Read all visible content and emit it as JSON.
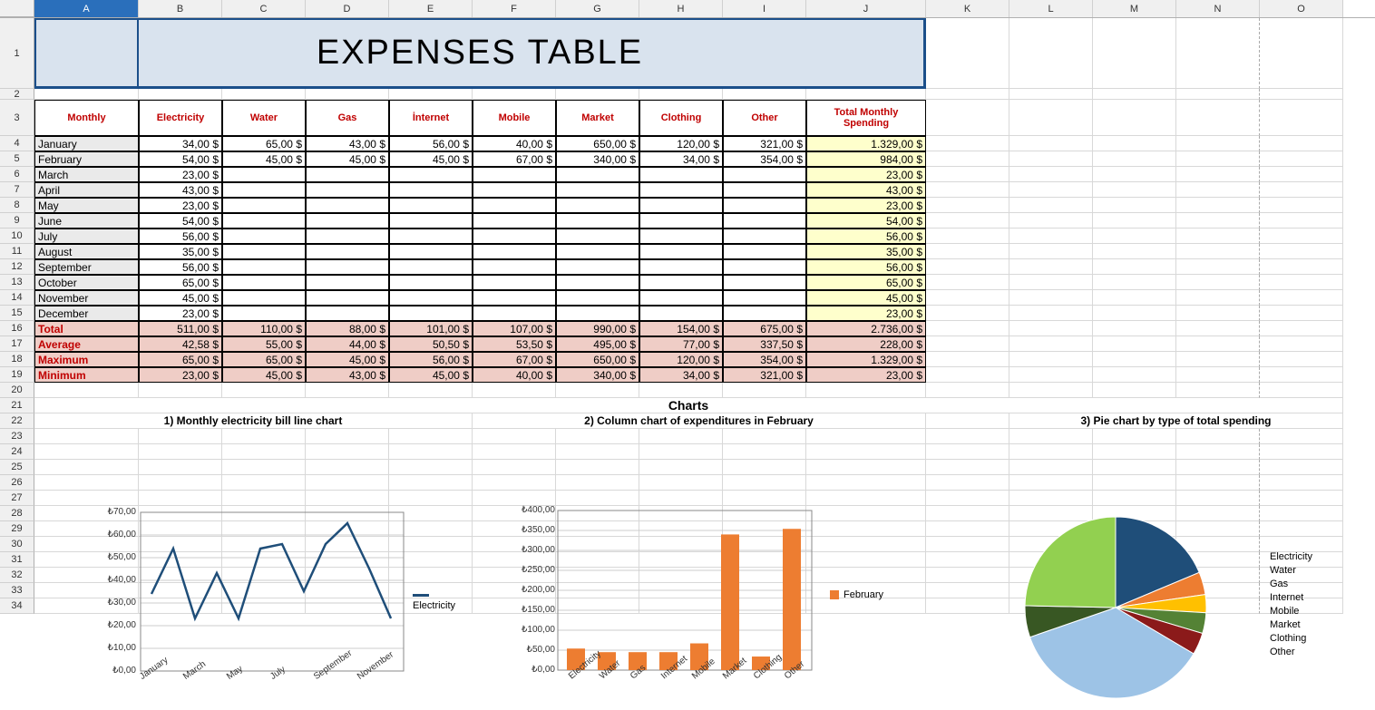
{
  "columns": [
    "A",
    "B",
    "C",
    "D",
    "E",
    "F",
    "G",
    "H",
    "I",
    "J",
    "K",
    "L",
    "M",
    "N",
    "O"
  ],
  "row_numbers": [
    1,
    2,
    3,
    4,
    5,
    6,
    7,
    8,
    9,
    10,
    11,
    12,
    13,
    14,
    15,
    16,
    17,
    18,
    19,
    20,
    21,
    22,
    23,
    24,
    25,
    26,
    27,
    28,
    29,
    30,
    31,
    32,
    33,
    34
  ],
  "title": "EXPENSES TABLE",
  "headers": {
    "A": "Monthly",
    "B": "Electricity",
    "C": "Water",
    "D": "Gas",
    "E": "İnternet",
    "F": "Mobile",
    "G": "Market",
    "H": "Clothing",
    "I": "Other",
    "J1": "Total Monthly",
    "J2": "Spending"
  },
  "months": [
    "January",
    "February",
    "March",
    "April",
    "May",
    "June",
    "July",
    "August",
    "September",
    "October",
    "November",
    "December"
  ],
  "data": {
    "January": {
      "B": "34,00 $",
      "C": "65,00 $",
      "D": "43,00 $",
      "E": "56,00 $",
      "F": "40,00 $",
      "G": "650,00 $",
      "H": "120,00 $",
      "I": "321,00 $",
      "J": "1.329,00 $"
    },
    "February": {
      "B": "54,00 $",
      "C": "45,00 $",
      "D": "45,00 $",
      "E": "45,00 $",
      "F": "67,00 $",
      "G": "340,00 $",
      "H": "34,00 $",
      "I": "354,00 $",
      "J": "984,00 $"
    },
    "March": {
      "B": "23,00 $",
      "J": "23,00 $"
    },
    "April": {
      "B": "43,00 $",
      "J": "43,00 $"
    },
    "May": {
      "B": "23,00 $",
      "J": "23,00 $"
    },
    "June": {
      "B": "54,00 $",
      "J": "54,00 $"
    },
    "July": {
      "B": "56,00 $",
      "J": "56,00 $"
    },
    "August": {
      "B": "35,00 $",
      "J": "35,00 $"
    },
    "September": {
      "B": "56,00 $",
      "J": "56,00 $"
    },
    "October": {
      "B": "65,00 $",
      "J": "65,00 $"
    },
    "November": {
      "B": "45,00 $",
      "J": "45,00 $"
    },
    "December": {
      "B": "23,00 $",
      "J": "23,00 $"
    }
  },
  "summary": {
    "Total": {
      "B": "511,00 $",
      "C": "110,00 $",
      "D": "88,00 $",
      "E": "101,00 $",
      "F": "107,00 $",
      "G": "990,00 $",
      "H": "154,00 $",
      "I": "675,00 $",
      "J": "2.736,00 $"
    },
    "Average": {
      "B": "42,58 $",
      "C": "55,00 $",
      "D": "44,00 $",
      "E": "50,50 $",
      "F": "53,50 $",
      "G": "495,00 $",
      "H": "77,00 $",
      "I": "337,50 $",
      "J": "228,00 $"
    },
    "Maximum": {
      "B": "65,00 $",
      "C": "65,00 $",
      "D": "45,00 $",
      "E": "56,00 $",
      "F": "67,00 $",
      "G": "650,00 $",
      "H": "120,00 $",
      "I": "354,00 $",
      "J": "1.329,00 $"
    },
    "Minimum": {
      "B": "23,00 $",
      "C": "45,00 $",
      "D": "43,00 $",
      "E": "45,00 $",
      "F": "40,00 $",
      "G": "340,00 $",
      "H": "34,00 $",
      "I": "321,00 $",
      "J": "23,00 $"
    }
  },
  "summary_order": [
    "Total",
    "Average",
    "Maximum",
    "Minimum"
  ],
  "charts_label": "Charts",
  "chart1_title": "1) Monthly electricity bill line chart",
  "chart2_title": "2) Column chart of expenditures in February",
  "chart3_title": "3) Pie chart by type of total spending",
  "chart1_legend": "Electricity",
  "chart2_legend": "February",
  "pie_legend": [
    "Electricity",
    "Water",
    "Gas",
    "Internet",
    "Mobile",
    "Market",
    "Clothing",
    "Other"
  ],
  "pie_colors": [
    "#1f4e79",
    "#ed7d31",
    "#ffc000",
    "#548235",
    "#8b1a1a",
    "#9dc3e6",
    "#385723",
    "#92d050"
  ],
  "chart_data": [
    {
      "type": "line",
      "title": "1) Monthly electricity bill line chart",
      "series": [
        {
          "name": "Electricity",
          "values": [
            34,
            54,
            23,
            43,
            23,
            54,
            56,
            35,
            56,
            65,
            45,
            23
          ]
        }
      ],
      "categories": [
        "January",
        "February",
        "March",
        "April",
        "May",
        "June",
        "July",
        "August",
        "September",
        "October",
        "November",
        "December"
      ],
      "xticks": [
        "January",
        "March",
        "May",
        "July",
        "September",
        "November"
      ],
      "yticks": [
        "₺0,00",
        "₺10,00",
        "₺20,00",
        "₺30,00",
        "₺40,00",
        "₺50,00",
        "₺60,00",
        "₺70,00"
      ],
      "ylim": [
        0,
        70
      ]
    },
    {
      "type": "bar",
      "title": "2) Column chart of expenditures in February",
      "categories": [
        "Electricity",
        "Water",
        "Gas",
        "Internet",
        "Mobile",
        "Market",
        "Clothing",
        "Other"
      ],
      "series": [
        {
          "name": "February",
          "values": [
            54,
            45,
            45,
            45,
            67,
            340,
            34,
            354
          ]
        }
      ],
      "yticks": [
        "₺0,00",
        "₺50,00",
        "₺100,00",
        "₺150,00",
        "₺200,00",
        "₺250,00",
        "₺300,00",
        "₺350,00",
        "₺400,00"
      ],
      "ylim": [
        0,
        400
      ]
    },
    {
      "type": "pie",
      "title": "3) Pie chart by type of total spending",
      "categories": [
        "Electricity",
        "Water",
        "Gas",
        "Internet",
        "Mobile",
        "Market",
        "Clothing",
        "Other"
      ],
      "values": [
        511,
        110,
        88,
        101,
        107,
        990,
        154,
        675
      ],
      "colors": [
        "#1f4e79",
        "#ed7d31",
        "#ffc000",
        "#548235",
        "#8b1a1a",
        "#9dc3e6",
        "#385723",
        "#92d050"
      ]
    }
  ]
}
